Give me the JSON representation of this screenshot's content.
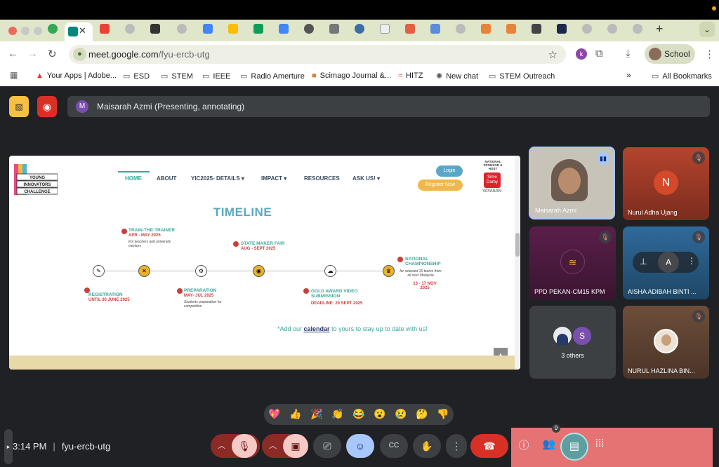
{
  "browser": {
    "url_host": "meet.google.com",
    "url_path": "/fyu-ercb-utg",
    "profile_label": "School",
    "bookmarks": [
      {
        "label": "Your Apps | Adobe...",
        "icon": "adobe-icon"
      },
      {
        "label": "ESD",
        "icon": "folder-icon"
      },
      {
        "label": "STEM",
        "icon": "folder-icon"
      },
      {
        "label": "IEEE",
        "icon": "folder-icon"
      },
      {
        "label": "Radio Amerture",
        "icon": "folder-icon"
      },
      {
        "label": "Scimago Journal &...",
        "icon": "sjr-icon"
      },
      {
        "label": "HITZ",
        "icon": "hitz-icon"
      },
      {
        "label": "New chat",
        "icon": "openai-icon"
      },
      {
        "label": "STEM Outreach",
        "icon": "folder-icon"
      }
    ],
    "all_bookmarks_label": "All Bookmarks"
  },
  "meet": {
    "presenter_initial": "M",
    "presenter_text": "Maisarah Azmi (Presenting, annotating)",
    "meeting_code": "fyu-ercb-utg",
    "time": "3:14 PM",
    "people_count": "9",
    "tiles": [
      {
        "name": "Maisarah Azmi",
        "type": "video"
      },
      {
        "name": "Nurul Adha Ujang",
        "initial": "N"
      },
      {
        "name": "PPD PEKAN-CM15 KPM"
      },
      {
        "name": "AISHA ADIBAH BINTI ..."
      },
      {
        "name": "3 others",
        "initial": "S"
      },
      {
        "name": "NURUL HAZLINA BIN..."
      }
    ],
    "reactions": [
      "💖",
      "👍",
      "🎉",
      "👏",
      "😂",
      "😮",
      "😢",
      "🤔",
      "👎"
    ]
  },
  "slide": {
    "logo_text": "YOUNG INNOVATORS CHALLENGE",
    "nav": [
      "HOME",
      "ABOUT",
      "YIC2025- DETAILS ▾",
      "IMPACT ▾",
      "RESOURCES",
      "ASK US! ▾"
    ],
    "login": "Login",
    "register": "Register Now",
    "sponsor_label": "NATIONAL SPONSOR & HOST",
    "sponsor_logo": "Sime Darby",
    "sponsor_name": "YAYASAN",
    "title": "TIMELINE",
    "events": [
      {
        "title": "REGISTRATION",
        "date": "UNTIL 30 JUNE 2025",
        "note": ""
      },
      {
        "title": "TRAIN-THE-TRAINER",
        "date": "APR - MAY 2025",
        "note": "For teachers and university mentors"
      },
      {
        "title": "PREPARATION",
        "date": "MAY- JUL 2025",
        "note": "Students preparation for competition"
      },
      {
        "title": "STATE MAKER FAIR",
        "date": "AUG - SEPT 2025",
        "note": ""
      },
      {
        "title": "GOLD AWARD VIDEO SUBMISSION",
        "date": "DEADLINE: 20 SEPT 2025",
        "note": ""
      },
      {
        "title": "NATIONAL CHAMPIONSHIP",
        "date": "13 - 17 NOV 2025",
        "note": "for selected 15 teams from all over Malaysia"
      }
    ],
    "note_prefix": "*Add our ",
    "note_link": "calendar",
    "note_suffix": " to yours to stay up to date with us!"
  }
}
